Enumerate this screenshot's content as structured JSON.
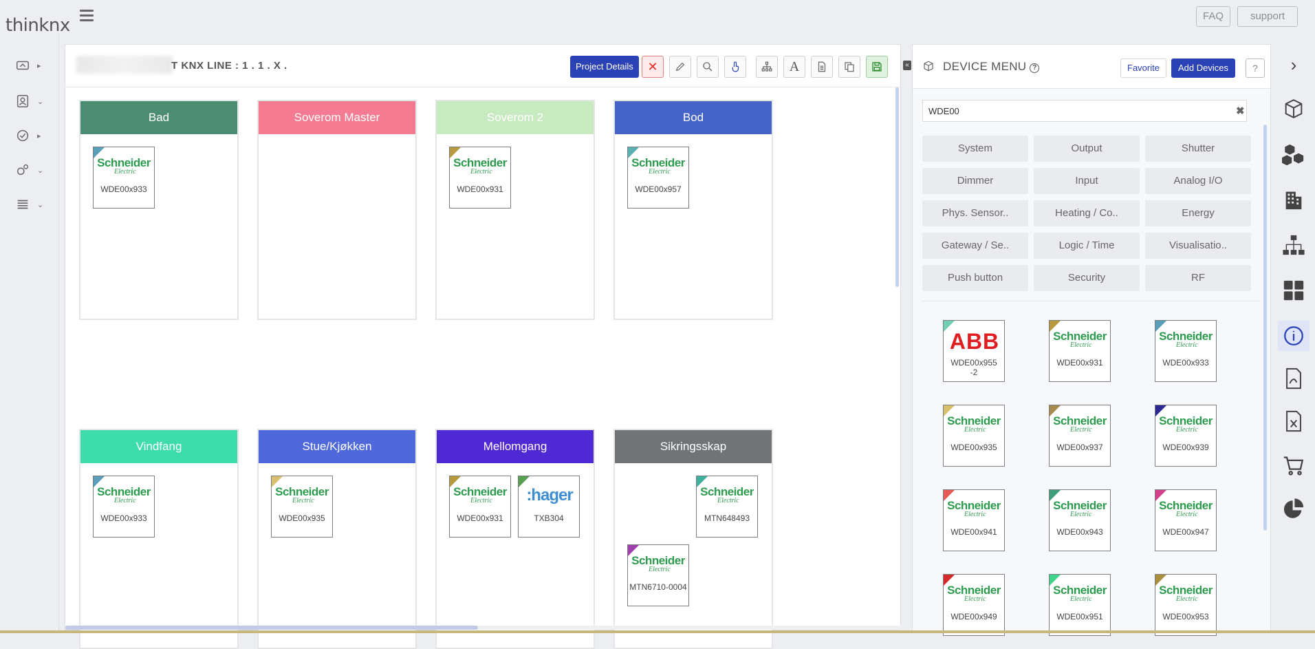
{
  "app": {
    "logo": "thinknx"
  },
  "top": {
    "faq": "FAQ",
    "support": "support"
  },
  "panel": {
    "line_label": "T KNX LINE : 1 . 1 . X .",
    "project_details": "Project Details"
  },
  "rooms": [
    {
      "title": "Bad",
      "color": "#4c8c72",
      "devices": [
        {
          "name": "WDE00x933",
          "brand": "schneider",
          "corner": "#5a9fb8"
        }
      ]
    },
    {
      "title": "Soverom Master",
      "color": "#f47b92",
      "devices": []
    },
    {
      "title": "Soverom 2",
      "color": "#c8eac0",
      "devices": [
        {
          "name": "WDE00x931",
          "brand": "schneider",
          "corner": "#b89a3e"
        }
      ]
    },
    {
      "title": "Bod",
      "color": "#4663c8",
      "devices": [
        {
          "name": "WDE00x957",
          "brand": "schneider",
          "corner": "#5ab0b0"
        }
      ]
    },
    {
      "title": "Vindfang",
      "color": "#3ddcaa",
      "devices": [
        {
          "name": "WDE00x933",
          "brand": "schneider",
          "corner": "#5a9fb8"
        }
      ]
    },
    {
      "title": "Stue/Kjøkken",
      "color": "#4f68dc",
      "devices": [
        {
          "name": "WDE00x935",
          "brand": "schneider",
          "corner": "#d8c070"
        }
      ]
    },
    {
      "title": "Mellomgang",
      "color": "#4f2ad4",
      "devices": [
        {
          "name": "WDE00x931",
          "brand": "schneider",
          "corner": "#b89a3e"
        },
        {
          "name": "TXB304",
          "brand": "hager",
          "corner": "#58a050"
        }
      ]
    },
    {
      "title": "Sikringsskap",
      "color": "#717477",
      "devices": [
        {
          "name": "MTN648493",
          "brand": "schneider",
          "corner": "#3fb0a0"
        },
        {
          "name": "MTN6710-0004",
          "brand": "schneider",
          "corner": "#a23fae"
        }
      ]
    }
  ],
  "device_menu": {
    "title": "DEVICE MENU",
    "favorite": "Favorite",
    "add_devices": "Add Devices",
    "help": "?",
    "search_value": "WDE00",
    "categories": [
      "System",
      "Output",
      "Shutter",
      "Dimmer",
      "Input",
      "Analog I/O",
      "Phys. Sensor..",
      "Heating / Co..",
      "Energy",
      "Gateway / Se..",
      "Logic / Time",
      "Visualisatio..",
      "Push button",
      "Security",
      "RF"
    ],
    "items": [
      {
        "name": "WDE00x955\n-2",
        "brand": "abb",
        "corner": "#6fcfb0"
      },
      {
        "name": "WDE00x931",
        "brand": "schneider",
        "corner": "#b89a3e"
      },
      {
        "name": "WDE00x933",
        "brand": "schneider",
        "corner": "#5a9fb8"
      },
      {
        "name": "WDE00x935",
        "brand": "schneider",
        "corner": "#d8c070"
      },
      {
        "name": "WDE00x937",
        "brand": "schneider",
        "corner": "#a88a4e"
      },
      {
        "name": "WDE00x939",
        "brand": "schneider",
        "corner": "#2c2a90"
      },
      {
        "name": "WDE00x941",
        "brand": "schneider",
        "corner": "#e65a5a"
      },
      {
        "name": "WDE00x943",
        "brand": "schneider",
        "corner": "#3f9f7a"
      },
      {
        "name": "WDE00x947",
        "brand": "schneider",
        "corner": "#d43f8a"
      },
      {
        "name": "WDE00x949",
        "brand": "schneider",
        "corner": "#d42a2a"
      },
      {
        "name": "WDE00x951",
        "brand": "schneider",
        "corner": "#3fd48a"
      },
      {
        "name": "WDE00x953",
        "brand": "schneider",
        "corner": "#a8903e"
      }
    ]
  },
  "brand_text": {
    "schneider_1": "Schneider",
    "schneider_2": "Electric",
    "hager": ":hager",
    "abb": "ABB"
  }
}
